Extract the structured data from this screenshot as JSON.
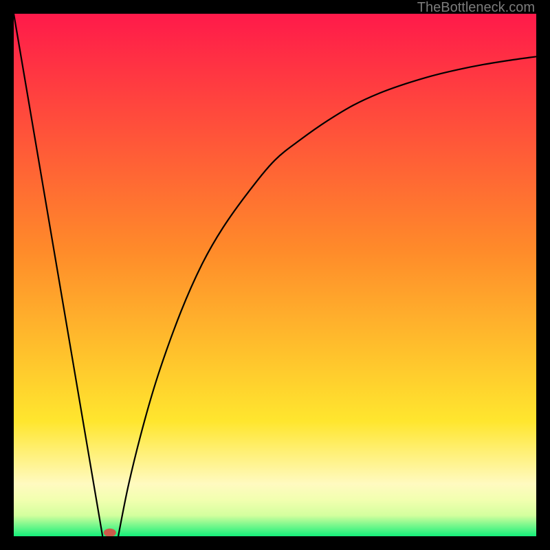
{
  "watermark": "TheBottleneck.com",
  "chart_data": {
    "type": "line",
    "title": "",
    "xlabel": "",
    "ylabel": "",
    "xlim": [
      0,
      100
    ],
    "ylim": [
      0,
      100
    ],
    "grid": false,
    "series": [
      {
        "name": "left-line",
        "x": [
          0,
          17
        ],
        "y": [
          100,
          0
        ]
      },
      {
        "name": "right-curve",
        "x": [
          20,
          22,
          25,
          28,
          32,
          36,
          40,
          45,
          50,
          55,
          60,
          65,
          70,
          75,
          80,
          85,
          90,
          95,
          100
        ],
        "y": [
          0,
          10,
          22,
          32,
          43,
          52,
          59,
          66,
          72,
          76,
          79.5,
          82.5,
          84.8,
          86.6,
          88.1,
          89.3,
          90.3,
          91.1,
          91.8
        ]
      }
    ],
    "background_gradient": {
      "top": "#ff1a4a",
      "mid1": "#ff8a2a",
      "mid2": "#ffe62e",
      "paleband1": "#fffac0",
      "paleband2": "#f2ffb0",
      "paleband3": "#d4ff9e",
      "bottom": "#14ef7a"
    },
    "marker": {
      "x": 18.4,
      "y": 0.7,
      "color": "#cc5a4a",
      "rx": 9,
      "ry": 6
    }
  }
}
